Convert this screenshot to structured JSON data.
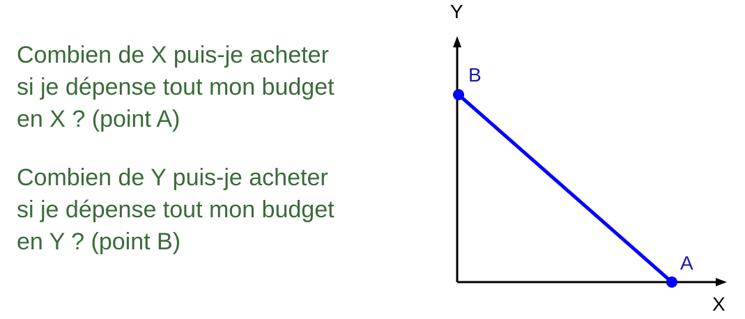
{
  "questions": [
    {
      "lines": [
        "Combien de X puis-je acheter",
        "si je dépense tout mon budget",
        "en X ? (point A)"
      ]
    },
    {
      "lines": [
        "Combien de Y puis-je acheter",
        "si je dépense tout mon budget",
        "en Y ? (point B)"
      ]
    }
  ],
  "diagram": {
    "x_axis_label": "X",
    "y_axis_label": "Y",
    "points": [
      {
        "label": "A"
      },
      {
        "label": "B"
      }
    ]
  },
  "colors": {
    "question_text": "#3a6b3a",
    "budget_line": "#0000ff",
    "point_label": "#1a1aa6",
    "axis": "#000000"
  }
}
